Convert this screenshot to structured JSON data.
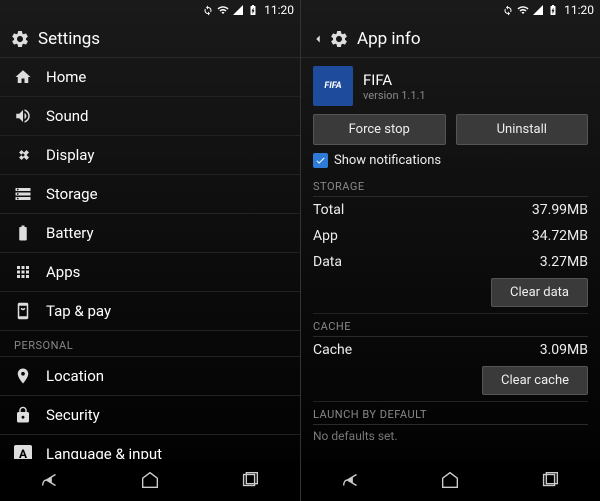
{
  "status": {
    "time": "11:20"
  },
  "left": {
    "title": "Settings",
    "items": [
      {
        "label": "Home"
      },
      {
        "label": "Sound"
      },
      {
        "label": "Display"
      },
      {
        "label": "Storage"
      },
      {
        "label": "Battery"
      },
      {
        "label": "Apps"
      },
      {
        "label": "Tap & pay"
      }
    ],
    "personal_header": "PERSONAL",
    "personal": [
      {
        "label": "Location"
      },
      {
        "label": "Security"
      },
      {
        "label": "Language & input"
      }
    ]
  },
  "right": {
    "title": "App info",
    "app": {
      "name": "FIFA",
      "icon_text": "FIFA",
      "version": "version 1.1.1"
    },
    "buttons": {
      "force_stop": "Force stop",
      "uninstall": "Uninstall"
    },
    "show_notifications": "Show notifications",
    "storage": {
      "header": "STORAGE",
      "total_label": "Total",
      "total_value": "37.99MB",
      "app_label": "App",
      "app_value": "34.72MB",
      "data_label": "Data",
      "data_value": "3.27MB",
      "clear_data": "Clear data"
    },
    "cache": {
      "header": "CACHE",
      "cache_label": "Cache",
      "cache_value": "3.09MB",
      "clear_cache": "Clear cache"
    },
    "launch": {
      "header": "LAUNCH BY DEFAULT",
      "text": "No defaults set."
    }
  }
}
